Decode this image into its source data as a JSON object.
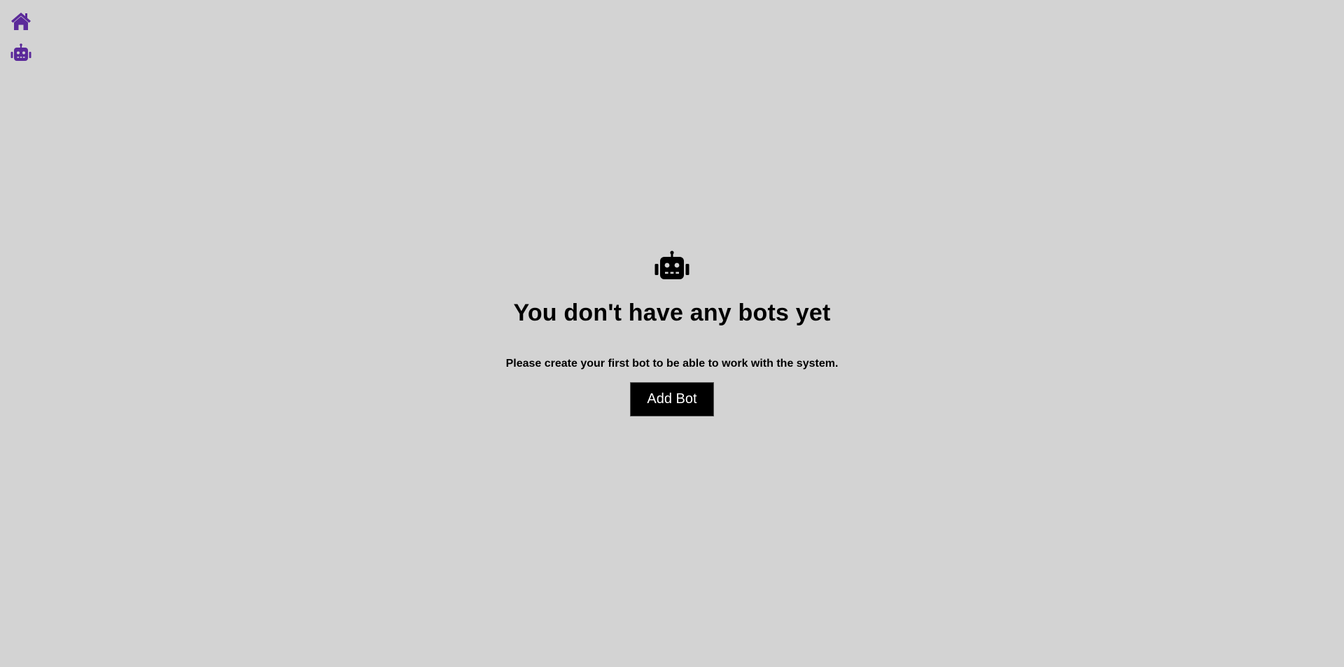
{
  "nav": {
    "items": [
      {
        "icon": "home-icon",
        "color": "#5b2a9a"
      },
      {
        "icon": "robot-icon",
        "color": "#5b2a9a"
      }
    ]
  },
  "empty_state": {
    "icon": "robot-icon",
    "title": "You don't have any bots yet",
    "subtitle": "Please create your first bot to be able to work with the system.",
    "button_label": "Add Bot"
  },
  "colors": {
    "background": "#d3d3d3",
    "accent": "#5b2a9a",
    "button_bg": "#000000",
    "button_text": "#ffffff"
  }
}
